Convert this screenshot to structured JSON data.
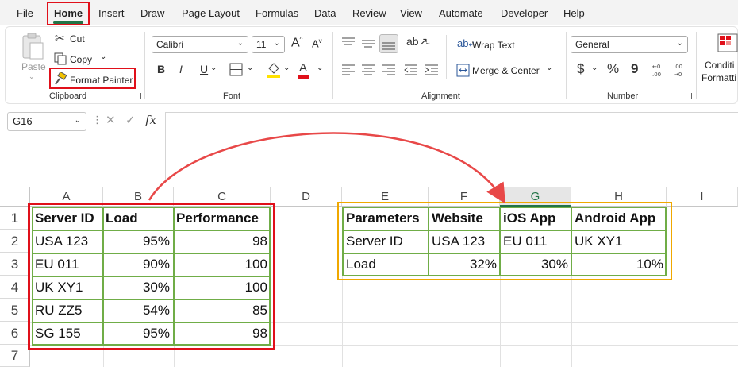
{
  "menu": {
    "tabs": [
      "File",
      "Home",
      "Insert",
      "Draw",
      "Page Layout",
      "Formulas",
      "Data",
      "Review",
      "View",
      "Automate",
      "Developer",
      "Help"
    ],
    "active": "Home"
  },
  "ribbon": {
    "clipboard": {
      "paste": "Paste",
      "cut": "Cut",
      "copy": "Copy",
      "format_painter": "Format Painter",
      "label": "Clipboard"
    },
    "font": {
      "family": "Calibri",
      "size": "11",
      "bold": "B",
      "italic": "I",
      "underline": "U",
      "label": "Font"
    },
    "alignment": {
      "wrap_text": "Wrap Text",
      "merge_center": "Merge & Center",
      "label": "Alignment"
    },
    "number": {
      "format": "General",
      "currency": "$",
      "percent": "%",
      "comma": "9",
      "label": "Number"
    },
    "styles": {
      "conditional": "Conditi",
      "formatting": "Formatti"
    }
  },
  "formula_bar": {
    "cell_ref": "G16",
    "fx": "fx",
    "value": ""
  },
  "columns": [
    "A",
    "B",
    "C",
    "D",
    "E",
    "F",
    "G",
    "H",
    "I"
  ],
  "rows": [
    "1",
    "2",
    "3",
    "4",
    "5",
    "6",
    "7"
  ],
  "selected_column": "G",
  "table1": {
    "headers": [
      "Server ID",
      "Load",
      "Performance"
    ],
    "rows": [
      [
        "USA 123",
        "95%",
        "98"
      ],
      [
        "EU 011",
        "90%",
        "100"
      ],
      [
        "UK XY1",
        "30%",
        "100"
      ],
      [
        "RU ZZ5",
        "54%",
        "85"
      ],
      [
        "SG 155",
        "95%",
        "98"
      ]
    ]
  },
  "table2": {
    "headers": [
      "Parameters",
      "Website",
      "iOS App",
      "Android App"
    ],
    "rows": [
      [
        "Server ID",
        "USA 123",
        "EU 011",
        "UK XY1"
      ],
      [
        "Load",
        "32%",
        "30%",
        "10%"
      ]
    ]
  },
  "colors": {
    "excel_green": "#217346",
    "table_border": "#70ad47",
    "highlight_red": "#e0101a",
    "highlight_orange": "#f0a800",
    "arrow_red": "#e84848"
  }
}
